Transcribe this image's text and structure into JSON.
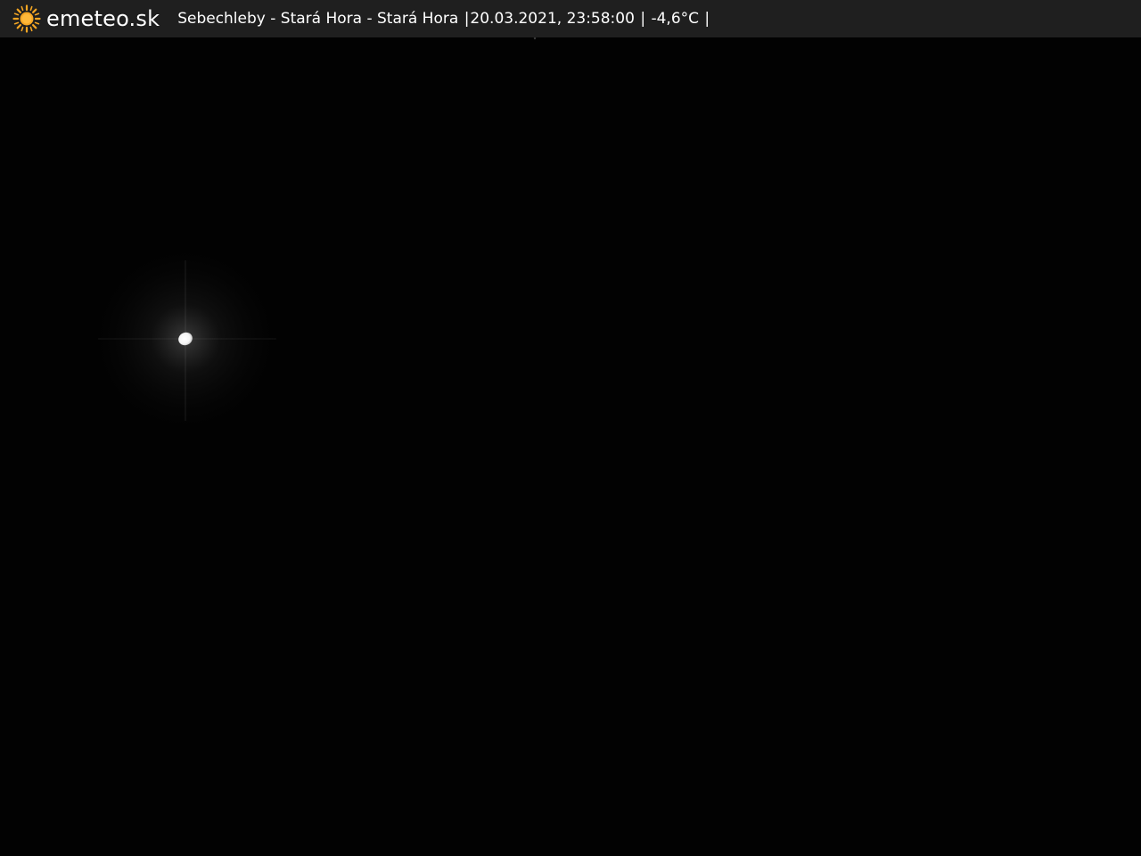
{
  "header": {
    "brand": "emeteo.sk",
    "brand_icon": "sun-icon",
    "brand_icon_color": "#f5a623",
    "location": "Sebechleby - Stará Hora - Stará Hora",
    "separator": "|",
    "datetime": "20.03.2021, 23:58:00",
    "temperature": "-4,6°C"
  },
  "colors": {
    "header_background": "#1f1f1f",
    "sky": "#020202",
    "moon": "#ffffff"
  }
}
